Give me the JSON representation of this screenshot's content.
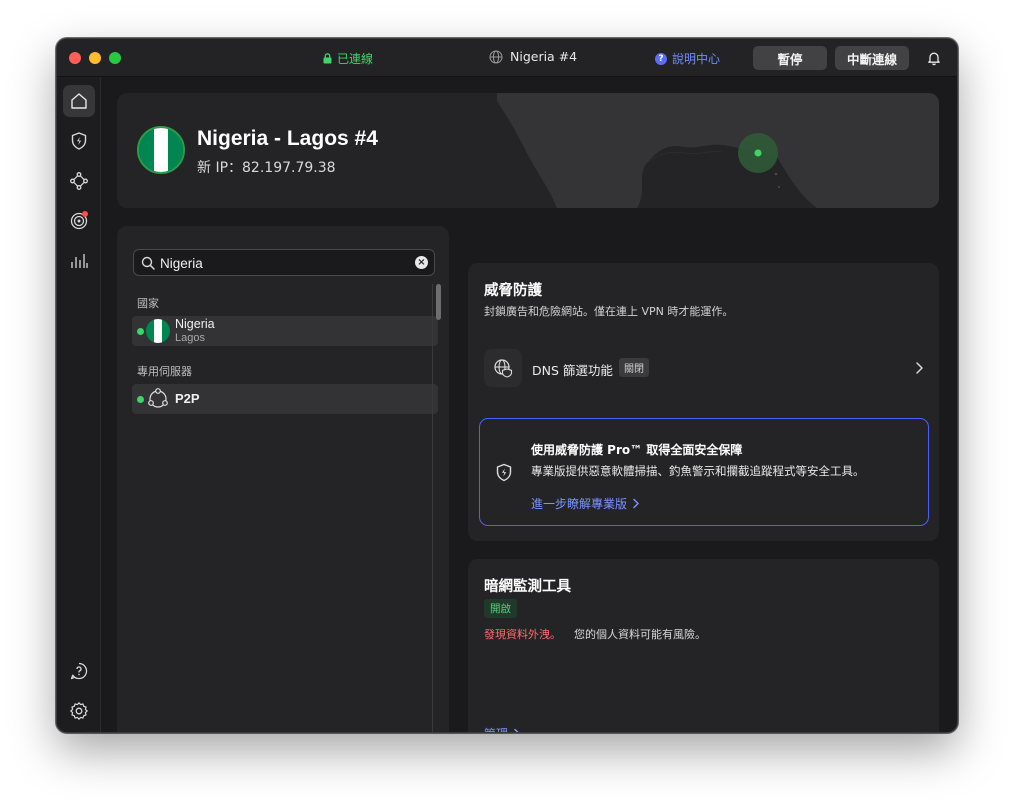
{
  "titlebar": {
    "status": "已連線",
    "server": "Nigeria #4",
    "help": "說明中心",
    "pause": "暫停",
    "disconnect": "中斷連線"
  },
  "sidebar": {
    "items": [
      {
        "icon": "home-icon"
      },
      {
        "icon": "shield-bolt-icon"
      },
      {
        "icon": "mesh-network-icon"
      },
      {
        "icon": "radar-icon"
      },
      {
        "icon": "bar-chart-icon"
      },
      {
        "icon": "help-icon"
      },
      {
        "icon": "settings-icon"
      }
    ]
  },
  "hero": {
    "title": "Nigeria - Lagos #4",
    "ip": "新 IP：82.197.79.38"
  },
  "servers": {
    "search_value": "Nigeria",
    "section_countries": "國家",
    "section_dedicated": "專用伺服器",
    "country_name": "Nigeria",
    "country_city": "Lagos",
    "p2p_name": "P2P"
  },
  "threat": {
    "title": "威脅防護",
    "subtitle": "封鎖廣告和危險網站。僅在連上 VPN 時才能運作。",
    "dns_label": "DNS 篩選功能",
    "dns_badge": "關閉",
    "promo_title": "使用威脅防護 Pro™ 取得全面安全保障",
    "promo_desc": "專業版提供惡意軟體掃描、釣魚警示和攔截追蹤程式等安全工具。",
    "promo_link": "進一步瞭解專業版"
  },
  "darkweb": {
    "title": "暗網監測工具",
    "badge": "開啟",
    "leak_alert": "發現資料外洩。",
    "leak_text": "您的個人資料可能有風險。",
    "manage": "管理"
  },
  "colors": {
    "accent_green": "#3ed46a",
    "accent_blue": "#4b61ff",
    "link_blue": "#7b92ff",
    "alert_red": "#ff6b6b",
    "flag_green": "#008751"
  }
}
